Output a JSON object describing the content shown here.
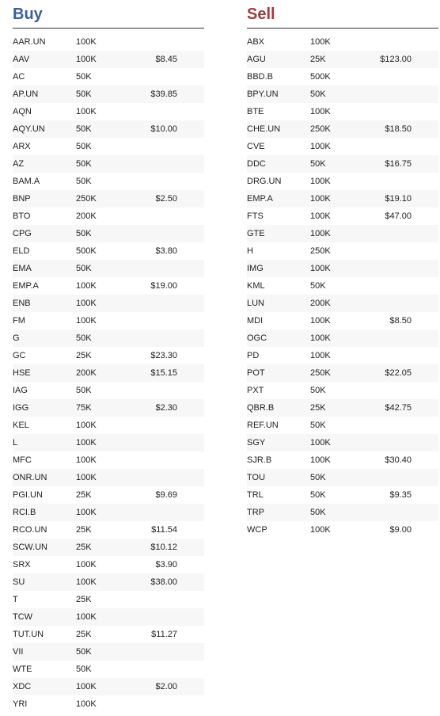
{
  "buy": {
    "title": "Buy",
    "rows": [
      {
        "symbol": "AAR.UN",
        "qty": "100K",
        "price": ""
      },
      {
        "symbol": "AAV",
        "qty": "100K",
        "price": "$8.45"
      },
      {
        "symbol": "AC",
        "qty": "50K",
        "price": ""
      },
      {
        "symbol": "AP.UN",
        "qty": "50K",
        "price": "$39.85"
      },
      {
        "symbol": "AQN",
        "qty": "100K",
        "price": ""
      },
      {
        "symbol": "AQY.UN",
        "qty": "50K",
        "price": "$10.00"
      },
      {
        "symbol": "ARX",
        "qty": "50K",
        "price": ""
      },
      {
        "symbol": "AZ",
        "qty": "50K",
        "price": ""
      },
      {
        "symbol": "BAM.A",
        "qty": "50K",
        "price": ""
      },
      {
        "symbol": "BNP",
        "qty": "250K",
        "price": "$2.50"
      },
      {
        "symbol": "BTO",
        "qty": "200K",
        "price": ""
      },
      {
        "symbol": "CPG",
        "qty": "50K",
        "price": ""
      },
      {
        "symbol": "ELD",
        "qty": "500K",
        "price": "$3.80"
      },
      {
        "symbol": "EMA",
        "qty": "50K",
        "price": ""
      },
      {
        "symbol": "EMP.A",
        "qty": "100K",
        "price": "$19.00"
      },
      {
        "symbol": "ENB",
        "qty": "100K",
        "price": ""
      },
      {
        "symbol": "FM",
        "qty": "100K",
        "price": ""
      },
      {
        "symbol": "G",
        "qty": "50K",
        "price": ""
      },
      {
        "symbol": "GC",
        "qty": "25K",
        "price": "$23.30"
      },
      {
        "symbol": "HSE",
        "qty": "200K",
        "price": "$15.15"
      },
      {
        "symbol": "IAG",
        "qty": "50K",
        "price": ""
      },
      {
        "symbol": "IGG",
        "qty": "75K",
        "price": "$2.30"
      },
      {
        "symbol": "KEL",
        "qty": "100K",
        "price": ""
      },
      {
        "symbol": "L",
        "qty": "100K",
        "price": ""
      },
      {
        "symbol": "MFC",
        "qty": "100K",
        "price": ""
      },
      {
        "symbol": "ONR.UN",
        "qty": "100K",
        "price": ""
      },
      {
        "symbol": "PGI.UN",
        "qty": "25K",
        "price": "$9.69"
      },
      {
        "symbol": "RCI.B",
        "qty": "100K",
        "price": ""
      },
      {
        "symbol": "RCO.UN",
        "qty": "25K",
        "price": "$11.54"
      },
      {
        "symbol": "SCW.UN",
        "qty": "25K",
        "price": "$10.12"
      },
      {
        "symbol": "SRX",
        "qty": "100K",
        "price": "$3.90"
      },
      {
        "symbol": "SU",
        "qty": "100K",
        "price": "$38.00"
      },
      {
        "symbol": "T",
        "qty": "25K",
        "price": ""
      },
      {
        "symbol": "TCW",
        "qty": "100K",
        "price": ""
      },
      {
        "symbol": "TUT.UN",
        "qty": "25K",
        "price": "$11.27"
      },
      {
        "symbol": "VII",
        "qty": "50K",
        "price": ""
      },
      {
        "symbol": "WTE",
        "qty": "50K",
        "price": ""
      },
      {
        "symbol": "XDC",
        "qty": "100K",
        "price": "$2.00"
      },
      {
        "symbol": "YRI",
        "qty": "100K",
        "price": ""
      }
    ]
  },
  "sell": {
    "title": "Sell",
    "rows": [
      {
        "symbol": "ABX",
        "qty": "100K",
        "price": ""
      },
      {
        "symbol": "AGU",
        "qty": "25K",
        "price": "$123.00"
      },
      {
        "symbol": "BBD.B",
        "qty": "500K",
        "price": ""
      },
      {
        "symbol": "BPY.UN",
        "qty": "50K",
        "price": ""
      },
      {
        "symbol": "BTE",
        "qty": "100K",
        "price": ""
      },
      {
        "symbol": "CHE.UN",
        "qty": "250K",
        "price": "$18.50"
      },
      {
        "symbol": "CVE",
        "qty": "100K",
        "price": ""
      },
      {
        "symbol": "DDC",
        "qty": "50K",
        "price": "$16.75"
      },
      {
        "symbol": "DRG.UN",
        "qty": "100K",
        "price": ""
      },
      {
        "symbol": "EMP.A",
        "qty": "100K",
        "price": "$19.10"
      },
      {
        "symbol": "FTS",
        "qty": "100K",
        "price": "$47.00"
      },
      {
        "symbol": "GTE",
        "qty": "100K",
        "price": ""
      },
      {
        "symbol": "H",
        "qty": "250K",
        "price": ""
      },
      {
        "symbol": "IMG",
        "qty": "100K",
        "price": ""
      },
      {
        "symbol": "KML",
        "qty": "50K",
        "price": ""
      },
      {
        "symbol": "LUN",
        "qty": "200K",
        "price": ""
      },
      {
        "symbol": "MDI",
        "qty": "100K",
        "price": "$8.50"
      },
      {
        "symbol": "OGC",
        "qty": "100K",
        "price": ""
      },
      {
        "symbol": "PD",
        "qty": "100K",
        "price": ""
      },
      {
        "symbol": "POT",
        "qty": "250K",
        "price": "$22.05"
      },
      {
        "symbol": "PXT",
        "qty": "50K",
        "price": ""
      },
      {
        "symbol": "QBR.B",
        "qty": "25K",
        "price": "$42.75"
      },
      {
        "symbol": "REF.UN",
        "qty": "50K",
        "price": ""
      },
      {
        "symbol": "SGY",
        "qty": "100K",
        "price": ""
      },
      {
        "symbol": "SJR.B",
        "qty": "100K",
        "price": "$30.40"
      },
      {
        "symbol": "TOU",
        "qty": "50K",
        "price": ""
      },
      {
        "symbol": "TRL",
        "qty": "50K",
        "price": "$9.35"
      },
      {
        "symbol": "TRP",
        "qty": "50K",
        "price": ""
      },
      {
        "symbol": "WCP",
        "qty": "100K",
        "price": "$9.00"
      }
    ]
  },
  "colors": {
    "buy_title": "#3a5f95",
    "sell_title": "#a23a3d",
    "row_stripe": "#f7f7f7"
  }
}
